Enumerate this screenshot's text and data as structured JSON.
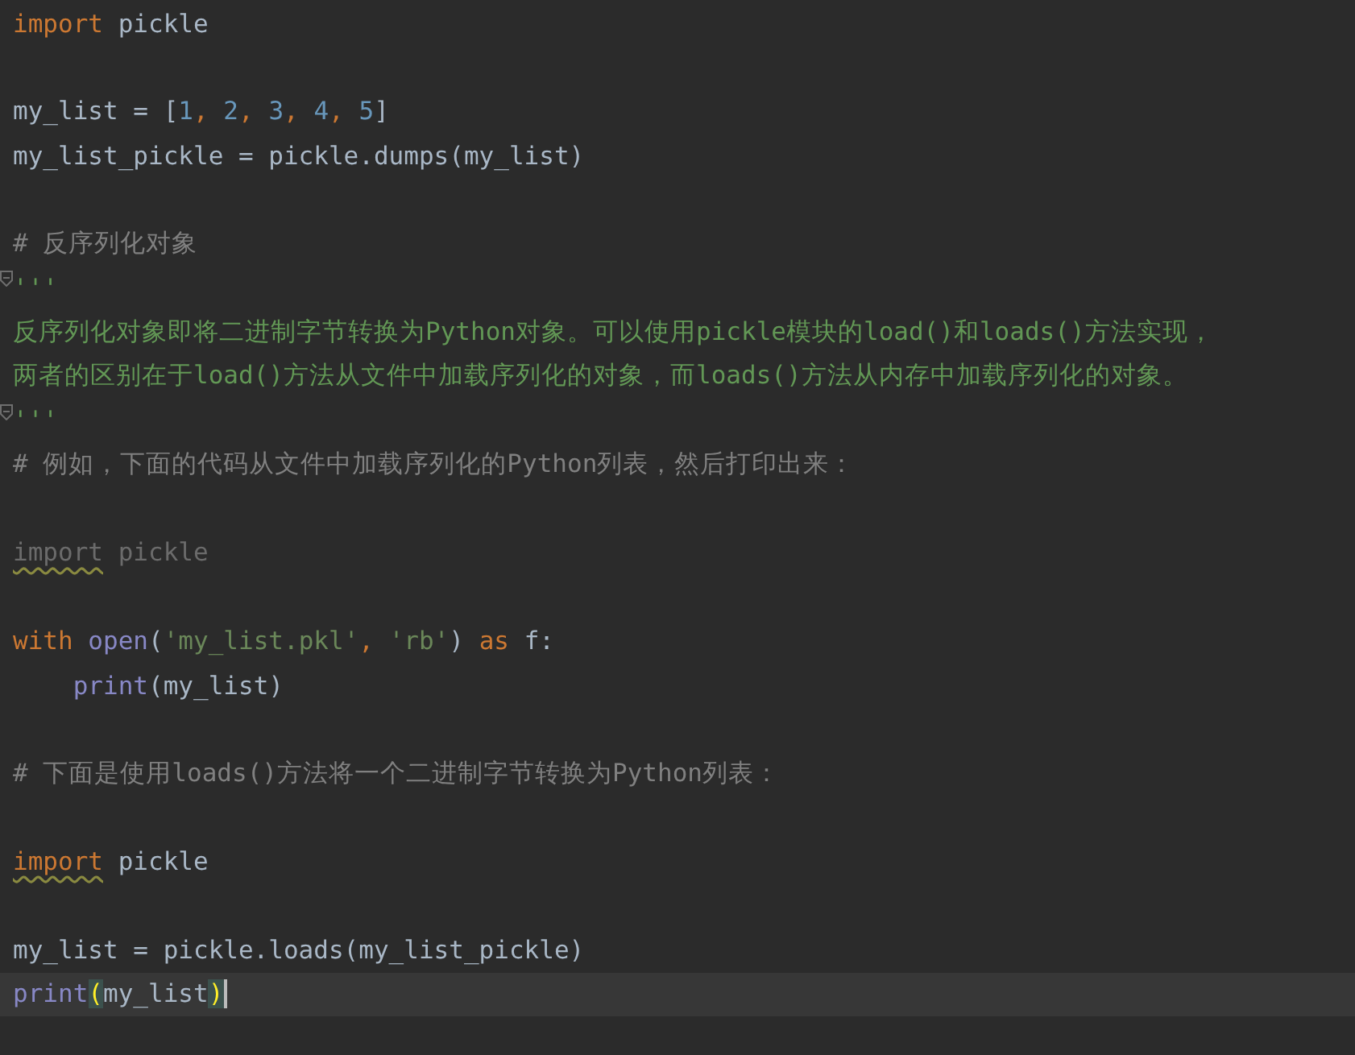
{
  "editor": {
    "lines": [
      {
        "current": false,
        "tokens": [
          {
            "text": "import",
            "kind": "keyword"
          },
          {
            "text": " pickle",
            "kind": "name"
          }
        ]
      },
      {
        "current": false
      },
      {
        "current": false,
        "tokens": [
          {
            "text": "my_list = [",
            "kind": "name"
          },
          {
            "text": "1",
            "kind": "number"
          },
          {
            "text": ", ",
            "kind": "keyword"
          },
          {
            "text": "2",
            "kind": "number"
          },
          {
            "text": ", ",
            "kind": "keyword"
          },
          {
            "text": "3",
            "kind": "number"
          },
          {
            "text": ", ",
            "kind": "keyword"
          },
          {
            "text": "4",
            "kind": "number"
          },
          {
            "text": ", ",
            "kind": "keyword"
          },
          {
            "text": "5",
            "kind": "number"
          },
          {
            "text": "]",
            "kind": "name"
          }
        ]
      },
      {
        "current": false,
        "tokens": [
          {
            "text": "my_list_pickle = pickle.dumps(my_list)",
            "kind": "name"
          }
        ]
      },
      {
        "current": false
      },
      {
        "current": false,
        "tokens": [
          {
            "text": "# 反序列化对象",
            "kind": "comment"
          }
        ]
      },
      {
        "current": false,
        "fold": true,
        "tokens": [
          {
            "text": "'''",
            "kind": "docstring"
          }
        ]
      },
      {
        "current": false,
        "tokens": [
          {
            "text": "反序列化对象即将二进制字节转换为Python对象。可以使用pickle模块的load()和loads()方法实现，",
            "kind": "docstring"
          }
        ]
      },
      {
        "current": false,
        "tokens": [
          {
            "text": "两者的区别在于load()方法从文件中加载序列化的对象，而loads()方法从内存中加载序列化的对象。",
            "kind": "docstring"
          }
        ]
      },
      {
        "current": false,
        "fold": true,
        "tokens": [
          {
            "text": "'''",
            "kind": "docstring"
          }
        ]
      },
      {
        "current": false,
        "tokens": [
          {
            "text": "# 例如，下面的代码从文件中加载序列化的Python列表，然后打印出来：",
            "kind": "comment"
          }
        ]
      },
      {
        "current": false
      },
      {
        "current": false,
        "tokens": [
          {
            "text": "import",
            "kind": "unused",
            "warning": true
          },
          {
            "text": " pickle",
            "kind": "unused"
          }
        ]
      },
      {
        "current": false
      },
      {
        "current": false,
        "tokens": [
          {
            "text": "with ",
            "kind": "keyword"
          },
          {
            "text": "open",
            "kind": "builtin"
          },
          {
            "text": "(",
            "kind": "name"
          },
          {
            "text": "'my_list.pkl'",
            "kind": "string"
          },
          {
            "text": ", ",
            "kind": "keyword"
          },
          {
            "text": "'rb'",
            "kind": "string"
          },
          {
            "text": ") ",
            "kind": "name"
          },
          {
            "text": "as",
            "kind": "keyword"
          },
          {
            "text": " f:",
            "kind": "name"
          }
        ]
      },
      {
        "current": false,
        "tokens": [
          {
            "text": "    print",
            "kind": "builtin"
          },
          {
            "text": "(my_list)",
            "kind": "name"
          }
        ]
      },
      {
        "current": false
      },
      {
        "current": false,
        "tokens": [
          {
            "text": "# 下面是使用loads()方法将一个二进制字节转换为Python列表：",
            "kind": "comment"
          }
        ]
      },
      {
        "current": false
      },
      {
        "current": false,
        "tokens": [
          {
            "text": "import",
            "kind": "keyword",
            "warning": true
          },
          {
            "text": " pickle",
            "kind": "name"
          }
        ]
      },
      {
        "current": false
      },
      {
        "current": false,
        "tokens": [
          {
            "text": "my_list = pickle.loads(my_list_pickle)",
            "kind": "name"
          }
        ]
      },
      {
        "current": true,
        "caret": true,
        "tokens": [
          {
            "text": "print",
            "kind": "builtin"
          },
          {
            "text": "(",
            "kind": "name",
            "matched": true
          },
          {
            "text": "my_list",
            "kind": "name"
          },
          {
            "text": ")",
            "kind": "name",
            "matched": true
          }
        ]
      }
    ]
  }
}
